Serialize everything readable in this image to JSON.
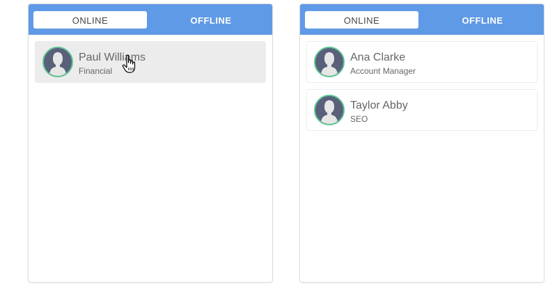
{
  "panels": [
    {
      "tabs": [
        "ONLINE",
        "OFFLINE"
      ],
      "active_tab": "ONLINE",
      "contacts": [
        {
          "name": "Paul Williams",
          "role": "Financial",
          "hovered": true
        }
      ]
    },
    {
      "tabs": [
        "ONLINE",
        "OFFLINE"
      ],
      "active_tab": "ONLINE",
      "contacts": [
        {
          "name": "Ana Clarke",
          "role": "Account Manager",
          "hovered": false
        },
        {
          "name": "Taylor Abby",
          "role": "SEO",
          "hovered": false
        }
      ]
    }
  ],
  "colors": {
    "tab_bar": "#5f9ae6",
    "avatar_ring": "#5cc394",
    "avatar_bg": "#58607a",
    "hover_bg": "#ececec"
  },
  "icons": {
    "avatar": "user-silhouette-icon",
    "cursor": "hand-pointer-cursor-icon"
  }
}
